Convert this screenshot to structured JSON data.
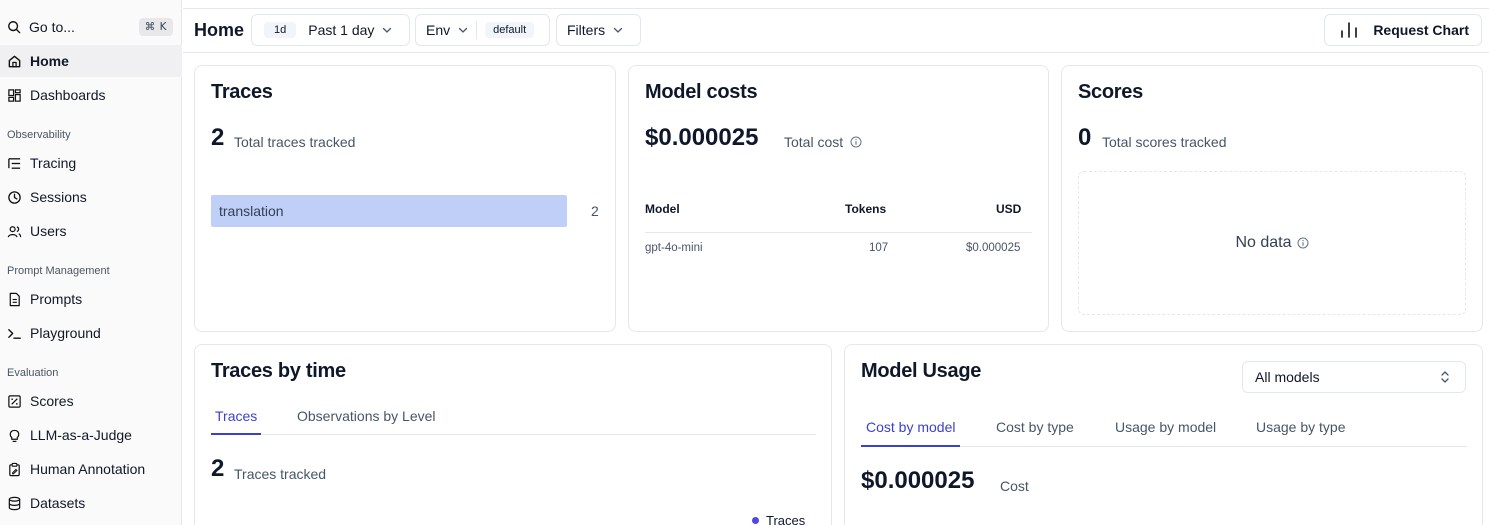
{
  "sidebar": {
    "goto_label": "Go to...",
    "goto_shortcut": "⌘ K",
    "items": [
      {
        "label": "Home"
      },
      {
        "label": "Dashboards"
      },
      {
        "label": "Tracing"
      },
      {
        "label": "Sessions"
      },
      {
        "label": "Users"
      },
      {
        "label": "Prompts"
      },
      {
        "label": "Playground"
      },
      {
        "label": "Scores"
      },
      {
        "label": "LLM-as-a-Judge"
      },
      {
        "label": "Human Annotation"
      },
      {
        "label": "Datasets"
      }
    ],
    "groups": [
      "Observability",
      "Prompt Management",
      "Evaluation"
    ]
  },
  "header": {
    "title": "Home",
    "range_pill": "1d",
    "range_label": "Past 1 day",
    "env_label": "Env",
    "env_value": "default",
    "filters_label": "Filters",
    "request_chart_label": "Request Chart"
  },
  "traces_card": {
    "title": "Traces",
    "total": "2",
    "total_label": "Total traces tracked",
    "bar_label": "translation",
    "bar_value": "2",
    "bar_fraction": 1.0
  },
  "costs_card": {
    "title": "Model costs",
    "total": "$0.000025",
    "total_label": "Total cost",
    "columns": [
      "Model",
      "Tokens",
      "USD"
    ],
    "rows": [
      {
        "model": "gpt-4o-mini",
        "tokens": "107",
        "usd": "$0.000025"
      }
    ]
  },
  "scores_card": {
    "title": "Scores",
    "total": "0",
    "total_label": "Total scores tracked",
    "empty_label": "No data"
  },
  "traces_time_card": {
    "title": "Traces by time",
    "tabs": [
      "Traces",
      "Observations by Level"
    ],
    "total": "2",
    "total_label": "Traces tracked",
    "legend": "Traces"
  },
  "usage_card": {
    "title": "Model Usage",
    "select_value": "All models",
    "tabs": [
      "Cost by model",
      "Cost by type",
      "Usage by model",
      "Usage by type"
    ],
    "total": "$0.000025",
    "total_label": "Cost"
  },
  "colors": {
    "accent": "#3b3fcf",
    "bar": "#bfcff7",
    "legend_dot": "#4f46e5"
  }
}
